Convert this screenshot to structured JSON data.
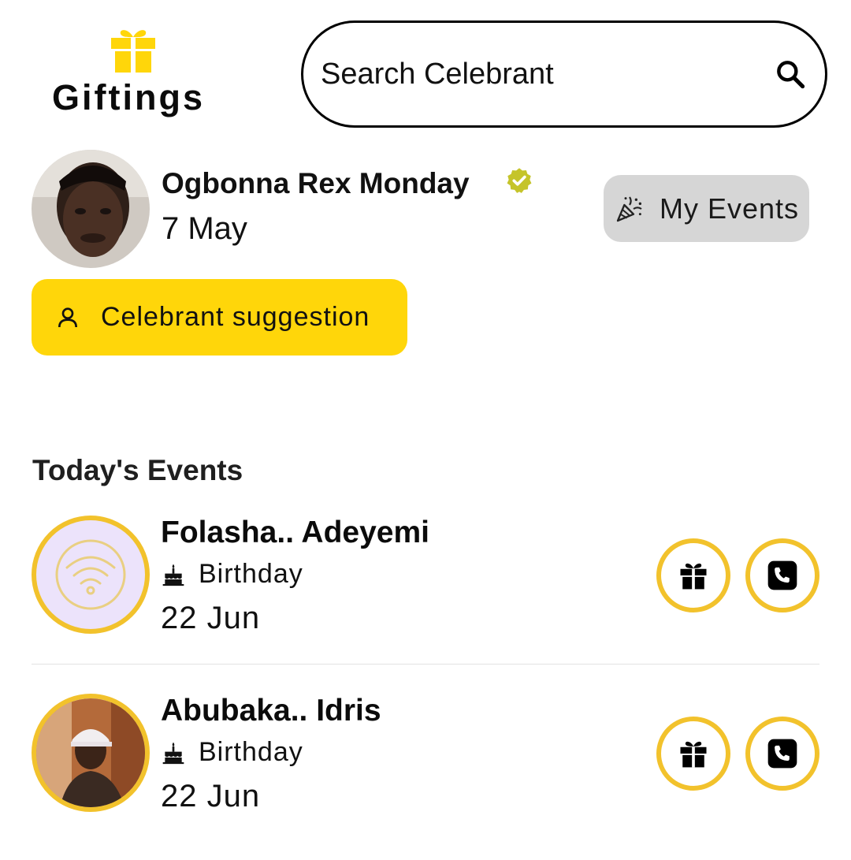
{
  "header": {
    "brand": "Giftings",
    "logo_icon": "gift-icon",
    "search_placeholder": "Search Celebrant",
    "search_icon": "search-icon"
  },
  "profile": {
    "name": "Ogbonna Rex Monday",
    "date": "7 May",
    "verified_icon": "verified-badge-icon",
    "my_events_label": "My Events",
    "my_events_icon": "party-popper-icon",
    "suggestion_label": "Celebrant suggestion",
    "suggestion_icon": "person-icon"
  },
  "events": {
    "title": "Today's Events",
    "items": [
      {
        "name": "Folasha.. Adeyemi",
        "type": "Birthday",
        "date": "22 Jun",
        "avatar": "placeholder-wifi-icon"
      },
      {
        "name": "Abubaka.. Idris",
        "type": "Birthday",
        "date": "22 Jun",
        "avatar": "photo"
      }
    ]
  },
  "colors": {
    "accent_yellow": "#ffd60a",
    "ring_yellow": "#f2c22c",
    "my_events_bg": "#d6d6d6",
    "verified_green": "#c5c42a"
  }
}
